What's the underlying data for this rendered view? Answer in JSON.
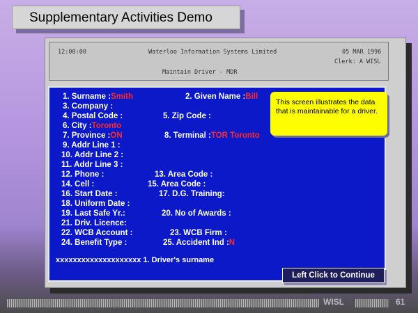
{
  "slide_title": "Supplementary Activities Demo",
  "header": {
    "time": "12:00:00",
    "company": "Waterloo Information Systems Limited",
    "date": "05 MAR 1996",
    "clerk": "Clerk: A WISL",
    "screen_name": "Maintain Driver - MDR"
  },
  "fields": [
    {
      "label": "1. Surname     :",
      "value": "Smith"
    },
    {
      "label": "2. Given Name :",
      "value": "Bill"
    },
    {
      "label": "3. Company      :",
      "value": ""
    },
    {
      "label": "4. Postal Code  :",
      "value": ""
    },
    {
      "label": "5. Zip Code :",
      "value": ""
    },
    {
      "label": "6. City         :",
      "value": "Toronto"
    },
    {
      "label": "7. Province    :",
      "value": "ON"
    },
    {
      "label": "8. Terminal :",
      "value": "TOR Toronto"
    },
    {
      "label": "9. Addr Line 1  :",
      "value": ""
    },
    {
      "label": "10. Addr Line 2  :",
      "value": ""
    },
    {
      "label": "11. Addr Line 3  :",
      "value": ""
    },
    {
      "label": "12. Phone :",
      "value": ""
    },
    {
      "label": "13. Area Code :",
      "value": ""
    },
    {
      "label": "14. Cell  :",
      "value": ""
    },
    {
      "label": "15. Area Code :",
      "value": ""
    },
    {
      "label": "16. Start Date   :",
      "value": ""
    },
    {
      "label": "17. D.G. Training:",
      "value": ""
    },
    {
      "label": "18. Uniform Date :",
      "value": ""
    },
    {
      "label": "19. Last Safe Yr.:",
      "value": ""
    },
    {
      "label": "20. No of Awards :",
      "value": ""
    },
    {
      "label": "21. Driv. Licence:",
      "value": ""
    },
    {
      "label": "22. WCB Account  :",
      "value": ""
    },
    {
      "label": "23. WCB Firm    :",
      "value": ""
    },
    {
      "label": "24. Benefit Type :",
      "value": ""
    },
    {
      "label": "25. Accident Ind :",
      "value": "N"
    }
  ],
  "note": "This screen illustrates the data that is maintainable for a driver.",
  "status_line": "xxxxxxxxxxxxxxxxxxxx 1. Driver's surname",
  "continue_button": "Left Click to Continue",
  "footer": {
    "brand": "WISL",
    "page": "61"
  },
  "colors": {
    "screen_bg": "#0b19c9",
    "value_text": "#ff2a2a",
    "note_bg": "#fffe00"
  }
}
